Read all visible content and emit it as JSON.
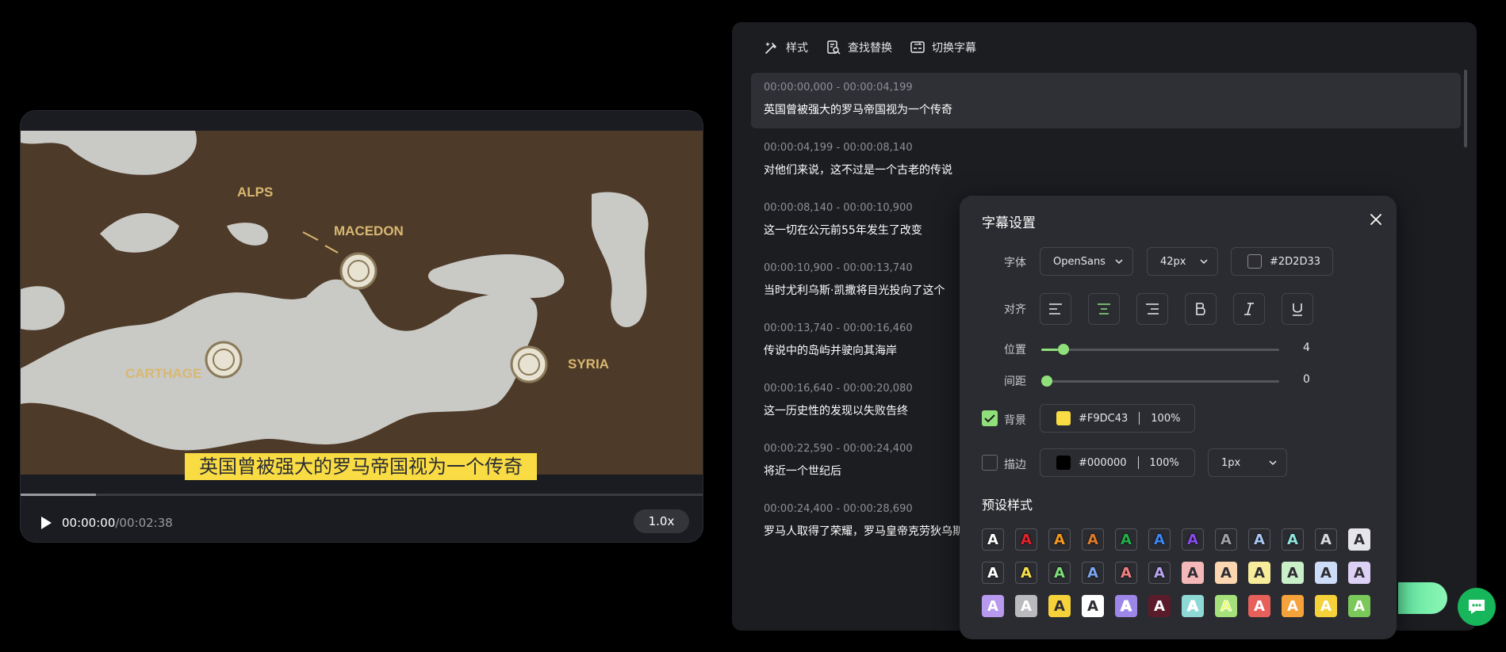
{
  "player": {
    "subtitle": "英国曾被强大的罗马帝国视为一个传奇",
    "current_time": "00:00:00",
    "total_time": "/00:02:38",
    "speed": "1.0x",
    "progress": 0.11,
    "map_labels": {
      "alps": "ALPS",
      "macedon": "MACEDON",
      "carthage": "CARTHAGE",
      "syria": "SYRIA"
    }
  },
  "toolbar": {
    "style_label": "样式",
    "find_replace_label": "查找替换",
    "switch_subtitle_label": "切换字幕"
  },
  "subtitles": [
    {
      "time": "00:00:00,000 - 00:00:04,199",
      "text": "英国曾被强大的罗马帝国视为一个传奇",
      "active": true
    },
    {
      "time": "00:00:04,199 - 00:00:08,140",
      "text": "对他们来说，这不过是一个古老的传说"
    },
    {
      "time": "00:00:08,140 - 00:00:10,900",
      "text": "这一切在公元前55年发生了改变"
    },
    {
      "time": "00:00:10,900 - 00:00:13,740",
      "text": "当时尤利乌斯·凯撒将目光投向了这个"
    },
    {
      "time": "00:00:13,740 - 00:00:16,460",
      "text": "传说中的岛屿并驶向其海岸"
    },
    {
      "time": "00:00:16,640 - 00:00:20,080",
      "text": "这一历史性的发现以失败告终"
    },
    {
      "time": "00:00:22,590 - 00:00:24,400",
      "text": "将近一个世纪后"
    },
    {
      "time": "00:00:24,400 - 00:00:28,690",
      "text": "罗马人取得了荣耀，罗马皇帝克劳狄乌斯"
    }
  ],
  "settings": {
    "title": "字幕设置",
    "font_label": "字体",
    "font_value": "OpenSans",
    "size_value": "42px",
    "text_color": "#2D2D33",
    "align_label": "对齐",
    "position_label": "位置",
    "position_value": "4",
    "position_fraction": 0.07,
    "spacing_label": "间距",
    "spacing_value": "0",
    "spacing_fraction": 0.0,
    "background_label": "背景",
    "background_checked": true,
    "background_color": "#F9DC43",
    "background_opacity": "100%",
    "stroke_label": "描边",
    "stroke_checked": false,
    "stroke_color": "#000000",
    "stroke_opacity": "100%",
    "stroke_width": "1px",
    "presets_title": "预设样式",
    "preset_glyph": "A"
  },
  "colors": {
    "accent_green": "#8fe07a",
    "subtitle_bg": "#F9DC43",
    "chat_green": "#17b65a"
  },
  "presets": [
    [
      {
        "bg": "transparent",
        "fg": "#ffffff",
        "border": "#55565c",
        "stroke": "#000"
      },
      {
        "bg": "transparent",
        "fg": "#e8202a",
        "border": "#55565c",
        "stroke": "#000"
      },
      {
        "bg": "transparent",
        "fg": "#f39a1e",
        "border": "#55565c",
        "stroke": "#000"
      },
      {
        "bg": "transparent",
        "fg": "#e07b2a",
        "border": "#55565c",
        "stroke": "#000"
      },
      {
        "bg": "transparent",
        "fg": "#22b14c",
        "border": "#55565c",
        "stroke": "#000"
      },
      {
        "bg": "transparent",
        "fg": "#3f86f0",
        "border": "#55565c",
        "stroke": "#000"
      },
      {
        "bg": "transparent",
        "fg": "#8a4cf0",
        "border": "#55565c",
        "stroke": "#000"
      },
      {
        "bg": "transparent",
        "fg": "#a0a0a5",
        "border": "#55565c",
        "stroke": "#000"
      },
      {
        "bg": "transparent",
        "fg": "#a9c8f5",
        "border": "#55565c",
        "stroke": "#000"
      },
      {
        "bg": "transparent",
        "fg": "#8ee8e0",
        "border": "#55565c",
        "stroke": "#000"
      },
      {
        "bg": "transparent",
        "fg": "#d9d9de",
        "border": "#55565c",
        "stroke": "none"
      },
      {
        "bg": "#e6e6ea",
        "fg": "#2d2d33",
        "border": "#e6e6ea",
        "stroke": "none"
      }
    ],
    [
      {
        "bg": "transparent",
        "fg": "#ffffff",
        "border": "#55565c",
        "stroke": "#000"
      },
      {
        "bg": "transparent",
        "fg": "#f5e04a",
        "border": "#55565c",
        "stroke": "#000"
      },
      {
        "bg": "transparent",
        "fg": "#7ee07a",
        "border": "#55565c",
        "stroke": "#000"
      },
      {
        "bg": "transparent",
        "fg": "#7aa6f0",
        "border": "#55565c",
        "stroke": "#000"
      },
      {
        "bg": "transparent",
        "fg": "#f08080",
        "border": "#55565c",
        "stroke": "#000"
      },
      {
        "bg": "transparent",
        "fg": "#b9a6f0",
        "border": "#55565c",
        "stroke": "#000"
      },
      {
        "bg": "#f5b8b8",
        "fg": "#2d2d33",
        "border": "#f5b8b8",
        "stroke": "none"
      },
      {
        "bg": "#fbd6b0",
        "fg": "#2d2d33",
        "border": "#fbd6b0",
        "stroke": "none"
      },
      {
        "bg": "#f7ec9a",
        "fg": "#2d2d33",
        "border": "#f7ec9a",
        "stroke": "none"
      },
      {
        "bg": "#c9f0c9",
        "fg": "#2d2d33",
        "border": "#c9f0c9",
        "stroke": "none"
      },
      {
        "bg": "#cddcf7",
        "fg": "#2d2d33",
        "border": "#cddcf7",
        "stroke": "none"
      },
      {
        "bg": "#ddd0f5",
        "fg": "#2d2d33",
        "border": "#ddd0f5",
        "stroke": "none"
      }
    ],
    [
      {
        "bg": "#b79af0",
        "fg": "#ffffff",
        "border": "#b79af0",
        "stroke": "none"
      },
      {
        "bg": "#b9b9be",
        "fg": "#ffffff",
        "border": "#b9b9be",
        "stroke": "none"
      },
      {
        "bg": "#f5d23a",
        "fg": "#2d2d33",
        "border": "#f5d23a",
        "stroke": "none"
      },
      {
        "bg": "#ffffff",
        "fg": "#2d2d33",
        "border": "#ffffff",
        "stroke": "none"
      },
      {
        "bg": "#9c86e8",
        "fg": "#ffffff",
        "border": "#9c86e8",
        "stroke": "outline"
      },
      {
        "bg": "#5a1c2a",
        "fg": "#ffffff",
        "border": "#5a1c2a",
        "stroke": "none"
      },
      {
        "bg": "#8ed8d6",
        "fg": "#ffffff",
        "border": "#8ed8d6",
        "stroke": "outline"
      },
      {
        "bg": "#a6e07a",
        "fg": "#e9ff50",
        "border": "#a6e07a",
        "stroke": "outline"
      },
      {
        "bg": "#e8605a",
        "fg": "#ffffff",
        "border": "#e8605a",
        "stroke": "none"
      },
      {
        "bg": "#f5a23a",
        "fg": "#ffffff",
        "border": "#f5a23a",
        "stroke": "none"
      },
      {
        "bg": "#f5d23a",
        "fg": "#ffffff",
        "border": "#f5d23a",
        "stroke": "none"
      },
      {
        "bg": "#7bc85a",
        "fg": "#ffffff",
        "border": "#7bc85a",
        "stroke": "none"
      }
    ]
  ]
}
